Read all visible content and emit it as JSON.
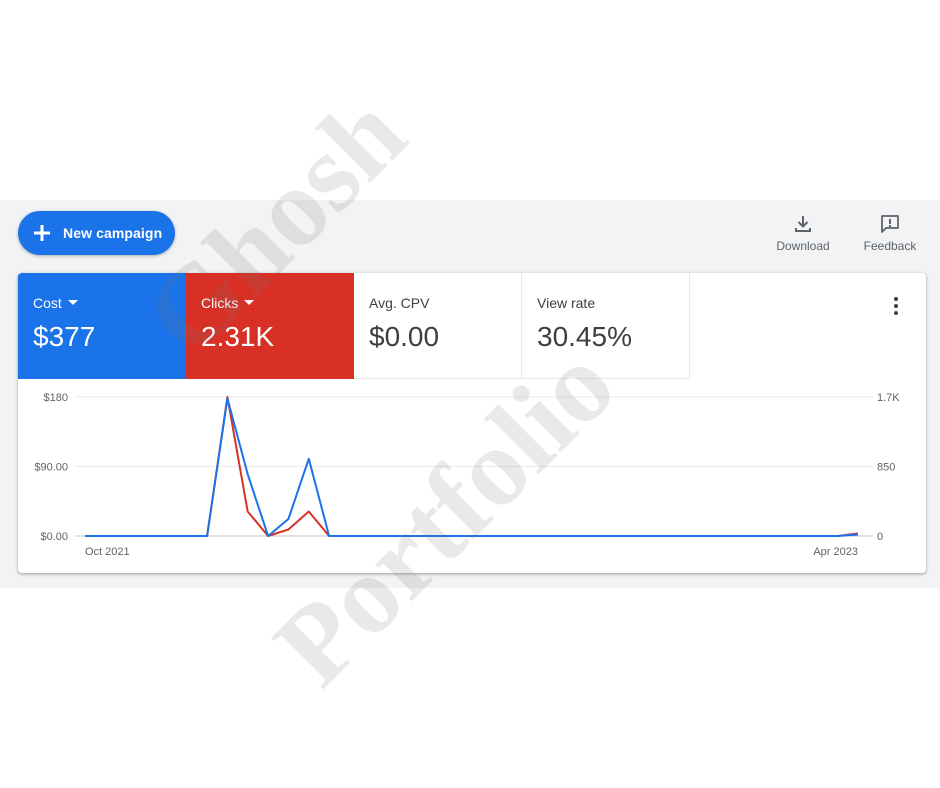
{
  "toolbar": {
    "new_campaign_label": "New campaign",
    "download_label": "Download",
    "feedback_label": "Feedback"
  },
  "metrics": [
    {
      "label": "Cost",
      "value": "$377",
      "has_dropdown": true,
      "color": "#1a73e8"
    },
    {
      "label": "Clicks",
      "value": "2.31K",
      "has_dropdown": true,
      "color": "#d93025"
    },
    {
      "label": "Avg. CPV",
      "value": "$0.00",
      "has_dropdown": false
    },
    {
      "label": "View rate",
      "value": "30.45%",
      "has_dropdown": false
    }
  ],
  "watermark": [
    "Ghosh",
    "Portfolio"
  ],
  "chart_data": {
    "type": "line",
    "x_labels": [
      "Oct 2021",
      "Apr 2023"
    ],
    "y_left_ticks": [
      "$0.00",
      "$90.00",
      "$180"
    ],
    "y_right_ticks": [
      "0",
      "850",
      "1.7K"
    ],
    "ylim_left": [
      0,
      180
    ],
    "ylim_right": [
      0,
      1700
    ],
    "grid": true,
    "series": [
      {
        "name": "Cost",
        "axis": "left",
        "color": "#1a73e8",
        "values": [
          0,
          0,
          0,
          0,
          0,
          0,
          0,
          178,
          80,
          0,
          22,
          100,
          0,
          0,
          0,
          0,
          0,
          0,
          0,
          0,
          0,
          0,
          0,
          0,
          0,
          0,
          0,
          0,
          0,
          0,
          0,
          0,
          0,
          0,
          0,
          0,
          0,
          0,
          2
        ]
      },
      {
        "name": "Clicks",
        "axis": "right",
        "color": "#d93025",
        "values": [
          0,
          0,
          0,
          0,
          0,
          0,
          0,
          1700,
          300,
          0,
          80,
          300,
          0,
          0,
          0,
          0,
          0,
          0,
          0,
          0,
          0,
          0,
          0,
          0,
          0,
          0,
          0,
          0,
          0,
          0,
          0,
          0,
          0,
          0,
          0,
          0,
          0,
          0,
          30
        ]
      }
    ]
  }
}
